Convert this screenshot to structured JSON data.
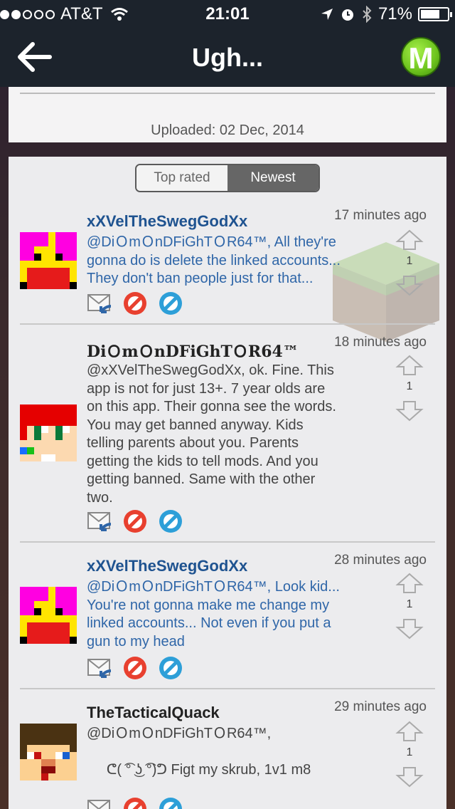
{
  "status_bar": {
    "carrier": "AT&T",
    "time": "21:01",
    "battery": "71%",
    "signal_bars_filled": 2,
    "signal_bars_total": 5,
    "battery_level": 0.71
  },
  "nav": {
    "title": "Ugh...",
    "logo_letter": "M"
  },
  "post": {
    "uploaded": "Uploaded: 02 Dec, 2014"
  },
  "tabs": [
    {
      "label": "Top rated",
      "selected": false
    },
    {
      "label": "Newest",
      "selected": true
    }
  ],
  "comments": [
    {
      "username": "xXVelTheSwegGodXx",
      "time": "17 minutes ago",
      "lines": [
        "@DiＯmＯnDFiGhTＯR64™, All they're",
        "gonna do is delete the linked accounts...",
        "They don't ban people just for that..."
      ],
      "votes": "1"
    },
    {
      "username": "DiＯmＯnDFiGhTＯR64™",
      "time": "18 minutes ago",
      "lines": [
        "@xXVelTheSwegGodXx, ok. Fine. This",
        "app is not for just 13+. 7 year olds are",
        "on this app. Their gonna see the words.",
        "You may get banned anyway. Kids",
        "telling parents about you. Parents",
        "getting the kids to tell mods. And you",
        "getting banned. Same with the other",
        "two."
      ],
      "votes": "1"
    },
    {
      "username": "xXVelTheSwegGodXx",
      "time": "28 minutes ago",
      "lines": [
        "@DiＯmＯnDFiGhTＯR64™, Look kid...",
        "You're not gonna make me change my",
        "linked accounts... Not even if you put a",
        "gun to my head"
      ],
      "votes": "1"
    },
    {
      "username": "TheTacticalQuack",
      "time": "29 minutes ago",
      "lines": [
        "@DiＯmＯnDFiGhTＯR64™,",
        "",
        "     ᕦ( ͡° ͜ʖ ͡°)ᕤ Figt my skrub, 1v1 m8"
      ],
      "votes": "1"
    }
  ],
  "colors": {
    "bar": "#1c232c",
    "link_blue": "#2f66a8",
    "name_blue": "#1f5390",
    "logo_green": "#6cc21d"
  },
  "icons": {
    "reply": "reply-icon",
    "report": "report-icon",
    "block": "block-icon",
    "up": "upvote-arrow-icon",
    "down": "downvote-arrow-icon"
  }
}
